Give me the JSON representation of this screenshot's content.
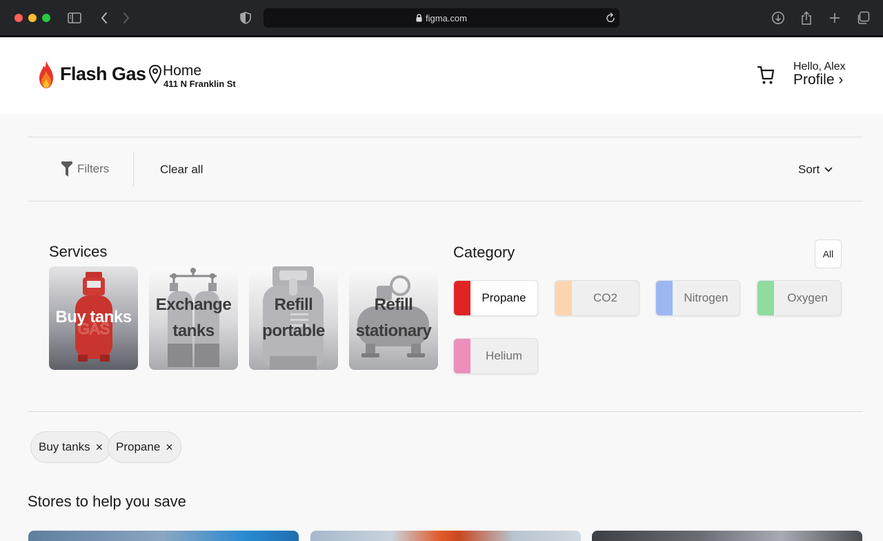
{
  "browser": {
    "url": "figma.com"
  },
  "header": {
    "brand": "Flash Gas",
    "location_name": "Home",
    "location_address": "411 N Franklin St",
    "greeting": "Hello, Alex",
    "profile_label": "Profile",
    "profile_chevron": "›"
  },
  "filter_bar": {
    "filters_label": "Filters",
    "clear_all_label": "Clear all",
    "sort_label": "Sort"
  },
  "services": {
    "title": "Services",
    "items": [
      {
        "label_line1": "Buy tanks",
        "label_line2": "",
        "icon": "gas-cylinder-icon",
        "selected": true
      },
      {
        "label_line1": "Exchange",
        "label_line2": "tanks",
        "icon": "twin-tanks-icon",
        "selected": false
      },
      {
        "label_line1": "Refill",
        "label_line2": "portable",
        "icon": "portable-tank-icon",
        "selected": false
      },
      {
        "label_line1": "Refill",
        "label_line2": "stationary",
        "icon": "stationary-tank-icon",
        "selected": false
      }
    ]
  },
  "category": {
    "title": "Category",
    "all_label": "All",
    "items": [
      {
        "label": "Propane",
        "color": "#e02424",
        "selected": true
      },
      {
        "label": "CO2",
        "color": "#fdd5b0",
        "selected": false
      },
      {
        "label": "Nitrogen",
        "color": "#9db7f2",
        "selected": false
      },
      {
        "label": "Oxygen",
        "color": "#8fdc9e",
        "selected": false
      },
      {
        "label": "Helium",
        "color": "#ec8fba",
        "selected": false
      }
    ]
  },
  "active_filters": [
    {
      "label": "Buy tanks",
      "remove": "×"
    },
    {
      "label": "Propane",
      "remove": "×"
    }
  ],
  "stores": {
    "title": "Stores to help you save"
  },
  "colors": {
    "accent": "#e02424",
    "chrome_bg": "#242528"
  }
}
